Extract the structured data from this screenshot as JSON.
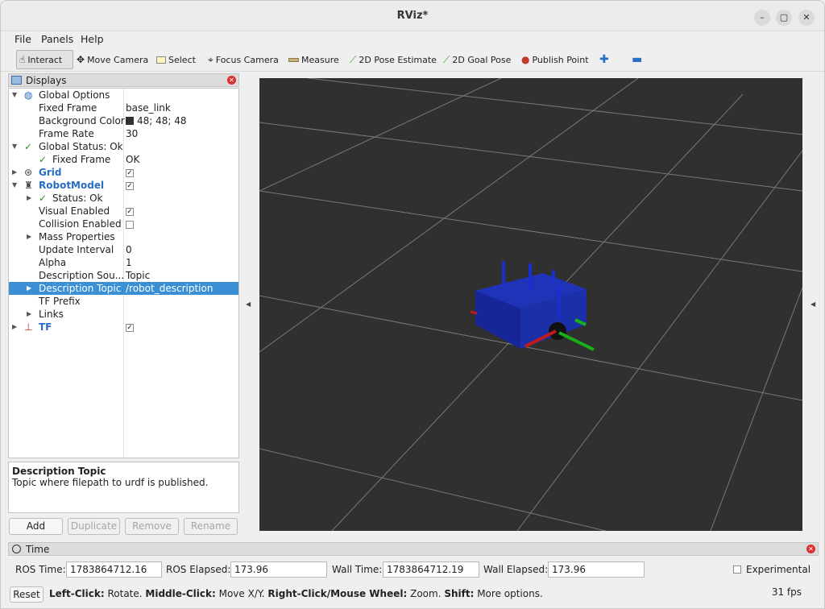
{
  "window": {
    "title": "RViz*"
  },
  "menu": {
    "file": "File",
    "panels": "Panels",
    "help": "Help"
  },
  "toolbar": {
    "interact": "Interact",
    "move_camera": "Move Camera",
    "select": "Select",
    "focus_camera": "Focus Camera",
    "measure": "Measure",
    "pose_estimate": "2D Pose Estimate",
    "goal_pose": "2D Goal Pose",
    "publish_point": "Publish Point"
  },
  "displays": {
    "title": "Displays",
    "rows": [
      {
        "key": "Global Options",
        "value": ""
      },
      {
        "key": "Fixed Frame",
        "value": "base_link"
      },
      {
        "key": "Background Color",
        "value": "48; 48; 48"
      },
      {
        "key": "Frame Rate",
        "value": "30"
      },
      {
        "key": "Global Status: Ok",
        "value": ""
      },
      {
        "key": "Fixed Frame",
        "value": "OK"
      },
      {
        "key": "Grid",
        "value": ""
      },
      {
        "key": "RobotModel",
        "value": ""
      },
      {
        "key": "Status: Ok",
        "value": ""
      },
      {
        "key": "Visual Enabled",
        "value": ""
      },
      {
        "key": "Collision Enabled",
        "value": ""
      },
      {
        "key": "Mass Properties",
        "value": ""
      },
      {
        "key": "Update Interval",
        "value": "0"
      },
      {
        "key": "Alpha",
        "value": "1"
      },
      {
        "key": "Description Sou...",
        "value": "Topic"
      },
      {
        "key": "Description Topic",
        "value": "/robot_description"
      },
      {
        "key": "TF Prefix",
        "value": ""
      },
      {
        "key": "Links",
        "value": ""
      },
      {
        "key": "TF",
        "value": ""
      }
    ],
    "checkbox_checked": "✓"
  },
  "description": {
    "title": "Description Topic",
    "body": "Topic where filepath to urdf is published."
  },
  "buttons": {
    "add": "Add",
    "duplicate": "Duplicate",
    "remove": "Remove",
    "rename": "Rename"
  },
  "time": {
    "title": "Time",
    "ros_time_label": "ROS Time:",
    "ros_time": "1783864712.16",
    "ros_elapsed_label": "ROS Elapsed:",
    "ros_elapsed": "173.96",
    "wall_time_label": "Wall Time:",
    "wall_time": "1783864712.19",
    "wall_elapsed_label": "Wall Elapsed:",
    "wall_elapsed": "173.96",
    "experimental": "Experimental"
  },
  "status": {
    "reset": "Reset",
    "lc": "Left-Click:",
    "lc_t": " Rotate. ",
    "mc": "Middle-Click:",
    "mc_t": " Move X/Y. ",
    "rc": "Right-Click/Mouse Wheel:",
    "rc_t": " Zoom. ",
    "sh": "Shift:",
    "sh_t": " More options.",
    "fps": "31 fps"
  },
  "colors": {
    "viewport_bg": "#303030",
    "selection": "#3a8fd5",
    "robot_body": "#1a2fa8"
  }
}
